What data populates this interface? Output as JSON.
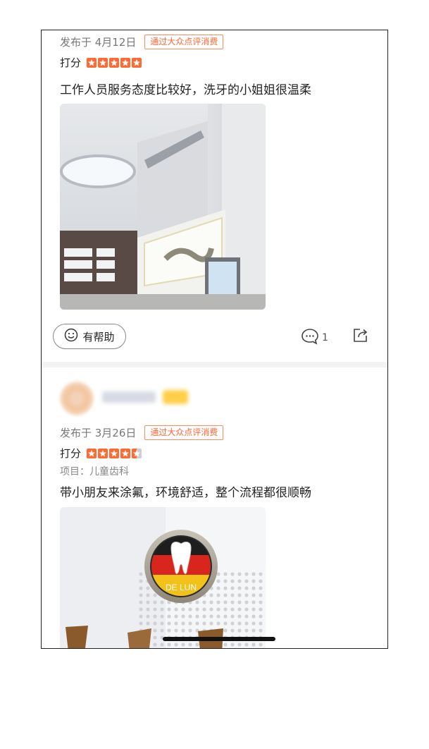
{
  "review1": {
    "date": "发布于 4月12日",
    "badge": "通过大众点评消费",
    "score_label": "打分",
    "rating": 5,
    "text": "工作人员服务态度比较好，洗牙的小姐姐很温柔",
    "helpful_label": "有帮助",
    "comment_count": "1"
  },
  "review2": {
    "date": "发布于 3月26日",
    "badge": "通过大众点评消费",
    "score_label": "打分",
    "rating": 4.5,
    "project": "项目：儿童齿科",
    "text": "带小朋友来涂氟，环境舒适，整个流程都很顺畅",
    "logo_text": "DE LUN"
  },
  "colors": {
    "accent": "#ff6633",
    "star": "#ff6a33"
  },
  "icons": [
    "smile-icon",
    "comment-icon",
    "share-icon",
    "star-icon"
  ]
}
